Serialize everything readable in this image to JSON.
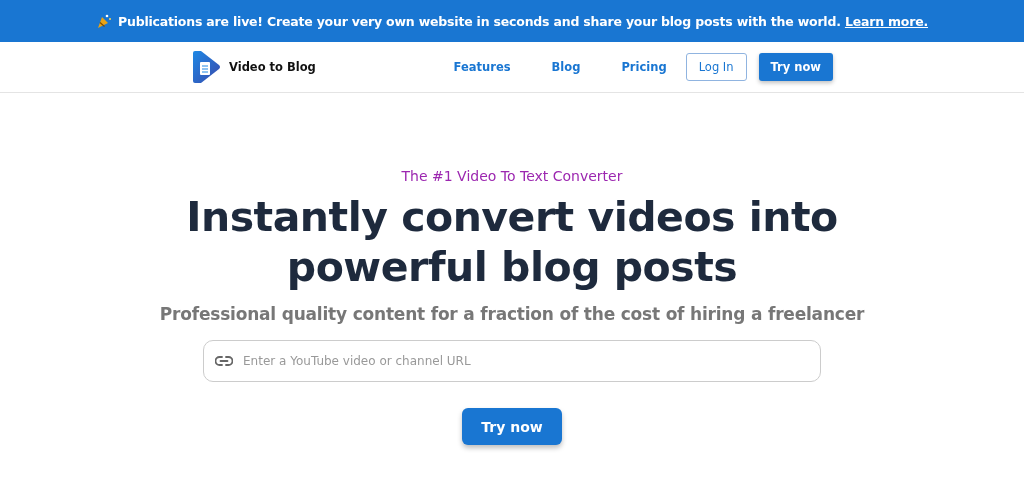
{
  "banner": {
    "text": "Publications are live! Create your very own website in seconds and share your blog posts with the world.",
    "link": "Learn more."
  },
  "nav": {
    "brand": "Video to Blog",
    "links": [
      "Features",
      "Blog",
      "Pricing"
    ],
    "login": "Log In",
    "cta": "Try now"
  },
  "hero": {
    "tagline": "The #1 Video To Text Converter",
    "headline": "Instantly convert videos into powerful blog posts",
    "subtitle": "Professional quality content for a fraction of the cost of hiring a freelancer",
    "input": {
      "placeholder": "Enter a YouTube video or channel URL"
    },
    "button": "Try now"
  }
}
